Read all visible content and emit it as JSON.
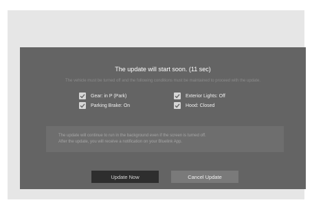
{
  "dialog": {
    "title": "The update will start soon. (11 sec)",
    "instruction": "The vehicle must be turned off and the following conditions must be maintained to proceed with the update.",
    "conditions": [
      {
        "label": "Gear: in P (Park)",
        "checked": true,
        "icon": "checkmark-icon"
      },
      {
        "label": "Parking Brake: On",
        "checked": true,
        "icon": "checkmark-icon"
      },
      {
        "label": "Exterior Lights: Off",
        "checked": true,
        "icon": "checkmark-icon"
      },
      {
        "label": "Hood: Closed",
        "checked": true,
        "icon": "checkmark-icon"
      }
    ],
    "notice_lines": [
      "The update will continue to run in the background even if the screen is turned off.",
      "After the update, you will receive a notification on your Bluelink App."
    ],
    "buttons": {
      "update_now": "Update Now",
      "cancel_update": "Cancel Update"
    }
  },
  "colors": {
    "dialog_background": "#646464",
    "update_button": "#2e2e2e",
    "cancel_button": "#7a7a7a",
    "checkbox": "#d6d6d6",
    "checkmark": "#646464"
  }
}
